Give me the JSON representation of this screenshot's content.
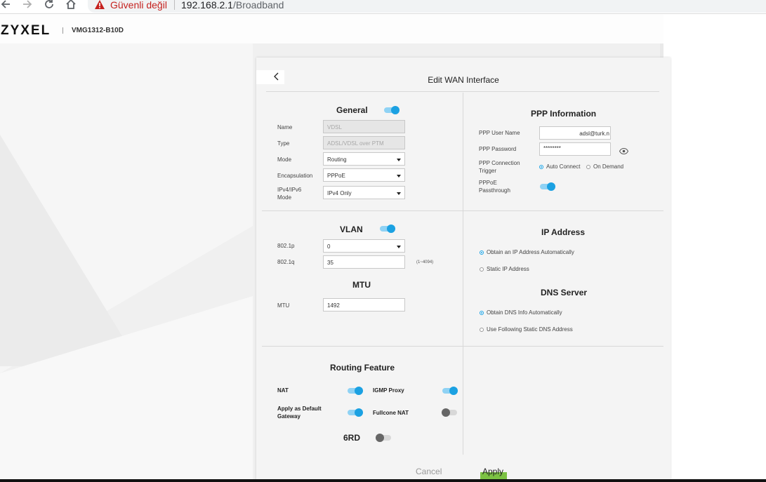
{
  "browser": {
    "security_text": "Güvenli değil",
    "url_host": "192.168.2.1",
    "url_path": "/Broadband"
  },
  "header": {
    "logo": "ZYXEL",
    "model": "VMG1312-B10D"
  },
  "dialog": {
    "title": "Edit WAN Interface",
    "cancel_label": "Cancel",
    "apply_label": "Apply"
  },
  "general": {
    "title": "General",
    "enabled": true,
    "name_label": "Name",
    "name_value": "VDSL",
    "type_label": "Type",
    "type_value": "ADSL/VDSL over PTM",
    "mode_label": "Mode",
    "mode_value": "Routing",
    "encapsulation_label": "Encapsulation",
    "encapsulation_value": "PPPoE",
    "ipmode_label_1": "IPv4/IPv6",
    "ipmode_label_2": "Mode",
    "ipmode_value": "IPv4 Only"
  },
  "ppp": {
    "title": "PPP Information",
    "username_label": "PPP User Name",
    "username_value": "adsl@turk.n",
    "password_label": "PPP Password",
    "password_value": "********",
    "trigger_label_1": "PPP Connection",
    "trigger_label_2": "Trigger",
    "trigger_option_auto": "Auto Connect",
    "trigger_option_demand": "On Demand",
    "trigger_selected": "Auto Connect",
    "passthrough_label_1": "PPPoE",
    "passthrough_label_2": "Passthrough",
    "passthrough_enabled": true
  },
  "vlan": {
    "title": "VLAN",
    "enabled": true,
    "p_label": "802.1p",
    "p_value": "0",
    "q_label": "802.1q",
    "q_value": "35",
    "q_hint": "(1~4094)"
  },
  "mtu": {
    "title": "MTU",
    "label": "MTU",
    "value": "1492"
  },
  "ip": {
    "title": "IP Address",
    "option_auto": "Obtain an IP Address Automatically",
    "option_static": "Static IP Address",
    "selected": "auto"
  },
  "dns": {
    "title": "DNS Server",
    "option_auto": "Obtain DNS Info Automatically",
    "option_static": "Use Following Static DNS Address",
    "selected": "auto"
  },
  "routing": {
    "title": "Routing Feature",
    "nat_label": "NAT",
    "nat_enabled": true,
    "igmp_label": "IGMP Proxy",
    "igmp_enabled": true,
    "default_gw_label_1": "Apply as Default",
    "default_gw_label_2": "Gateway",
    "default_gw_enabled": true,
    "fullcone_label": "Fullcone NAT",
    "fullcone_enabled": false,
    "sixrd_label": "6RD",
    "sixrd_enabled": false
  },
  "colors": {
    "accent": "#1ba1e2",
    "apply_bar": "#7cc243",
    "warning": "#c5221f"
  }
}
